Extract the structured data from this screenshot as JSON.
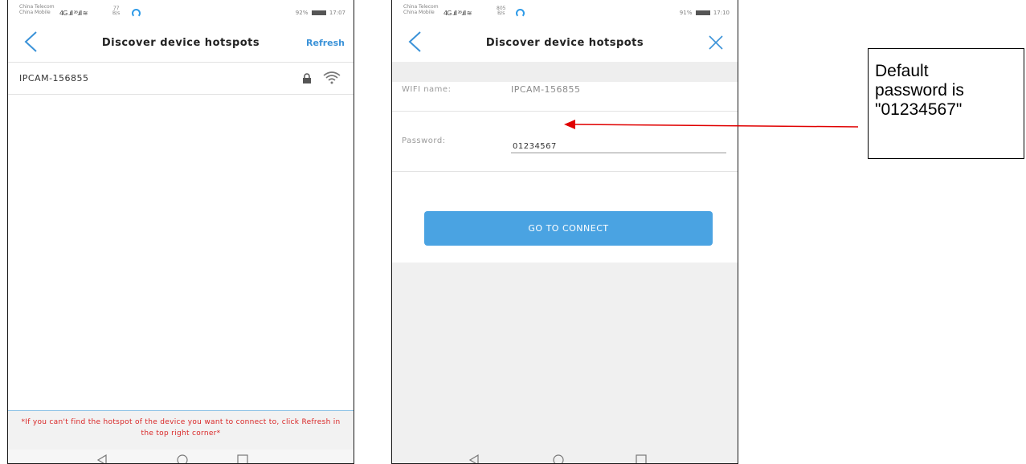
{
  "phone1": {
    "status": {
      "carrier_top": "China Telecom",
      "carrier_bottom": "China Mobile",
      "signal": "4G .ıll ²⁶.ıll ≋",
      "speed_value": "77",
      "speed_unit": "B/s",
      "battery": "92%",
      "time": "17:07"
    },
    "title": "Discover device hotspots",
    "refresh_label": "Refresh",
    "hotspots": [
      {
        "name": "IPCAM-156855"
      }
    ],
    "footer_note": "*If you can't find the hotspot of the device you want to connect to, click Refresh in the top right corner*"
  },
  "phone2": {
    "status": {
      "carrier_top": "China Telecom",
      "carrier_bottom": "China Mobile",
      "signal": "4G .ıll ²⁶.ıll ≋",
      "speed_value": "805",
      "speed_unit": "B/s",
      "battery": "91%",
      "time": "17:10"
    },
    "title": "Discover device hotspots",
    "wifi_label": "WIFI name:",
    "wifi_value": "IPCAM-156855",
    "password_label": "Password:",
    "password_value": "01234567",
    "connect_label": "GO TO CONNECT"
  },
  "callout": {
    "line1": "Default",
    "line2": "password is",
    "line3": "\"01234567\""
  },
  "colors": {
    "accent": "#3a92d8",
    "button": "#4aa3e2",
    "note": "#d92727",
    "arrow": "#e00000"
  }
}
